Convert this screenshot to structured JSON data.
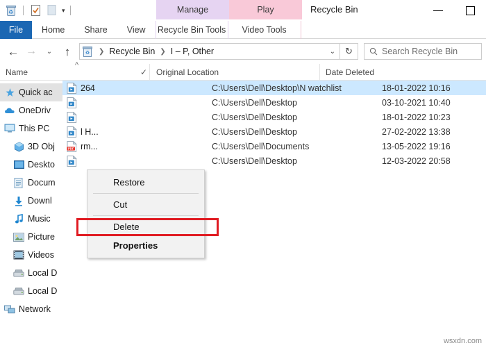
{
  "window": {
    "title": "Recycle Bin",
    "controls": {
      "minimize": "minimize-button",
      "maximize": "maximize-button"
    }
  },
  "quick_access_toolbar": {
    "items": [
      {
        "name": "recycle-bin-icon",
        "label": "Recycle Bin Properties"
      },
      {
        "name": "properties-icon",
        "label": "Properties"
      },
      {
        "name": "empty-recycle-bin-icon",
        "label": "Empty Recycle Bin"
      }
    ],
    "customize_caret": "▾"
  },
  "contextual_tabs": [
    {
      "header": "Manage",
      "tab": "Recycle Bin Tools",
      "color": "#e6d4f2"
    },
    {
      "header": "Play",
      "tab": "Video Tools",
      "color": "#f9c9d8"
    }
  ],
  "ribbon_tabs": [
    {
      "label": "File",
      "active": true
    },
    {
      "label": "Home",
      "active": false
    },
    {
      "label": "Share",
      "active": false
    },
    {
      "label": "View",
      "active": false
    }
  ],
  "address_bar": {
    "back": "←",
    "forward": "→",
    "recent": "⌄",
    "up": "↑",
    "breadcrumb": [
      "Recycle Bin",
      "I – P, Other"
    ],
    "separator": "❯",
    "dropdown_caret": "⌄",
    "refresh": "↻"
  },
  "search": {
    "placeholder": "Search Recycle Bin",
    "icon": "search-icon"
  },
  "columns": [
    {
      "label": "Name",
      "sort": "^"
    },
    {
      "label": "Original Location",
      "check": "✓"
    },
    {
      "label": "Date Deleted"
    }
  ],
  "sidebar": {
    "items": [
      {
        "label": "Quick ac",
        "icon": "pin-icon",
        "selected": true,
        "indent": false
      },
      {
        "label": "OneDriv",
        "icon": "cloud-icon",
        "selected": false,
        "indent": false
      },
      {
        "label": "This PC",
        "icon": "monitor-icon",
        "selected": false,
        "indent": false
      },
      {
        "label": "3D Obj",
        "icon": "3d-objects-icon",
        "selected": false,
        "indent": true
      },
      {
        "label": "Deskto",
        "icon": "desktop-icon",
        "selected": false,
        "indent": true
      },
      {
        "label": "Docum",
        "icon": "documents-icon",
        "selected": false,
        "indent": true
      },
      {
        "label": "Downl",
        "icon": "downloads-icon",
        "selected": false,
        "indent": true
      },
      {
        "label": "Music",
        "icon": "music-icon",
        "selected": false,
        "indent": true
      },
      {
        "label": "Picture",
        "icon": "pictures-icon",
        "selected": false,
        "indent": true
      },
      {
        "label": "Videos",
        "icon": "videos-icon",
        "selected": false,
        "indent": true
      },
      {
        "label": "Local D",
        "icon": "local-disk-icon",
        "selected": false,
        "indent": true
      },
      {
        "label": "Local D",
        "icon": "local-disk-icon",
        "selected": false,
        "indent": true
      },
      {
        "label": "Network",
        "icon": "network-icon",
        "selected": false,
        "indent": false
      }
    ]
  },
  "files": [
    {
      "name": "264",
      "location": "C:\\Users\\Dell\\Desktop\\N watchlist",
      "date": "18-01-2022 10:16",
      "icon": "video-file-icon",
      "selected": true
    },
    {
      "name": "",
      "location": "C:\\Users\\Dell\\Desktop",
      "date": "03-10-2021 10:40",
      "icon": "video-file-icon",
      "selected": false
    },
    {
      "name": "",
      "location": "C:\\Users\\Dell\\Desktop",
      "date": "18-01-2022 10:23",
      "icon": "video-file-icon",
      "selected": false
    },
    {
      "name": "l H...",
      "location": "C:\\Users\\Dell\\Desktop",
      "date": "27-02-2022 13:38",
      "icon": "video-file-icon",
      "selected": false
    },
    {
      "name": "rm...",
      "location": "C:\\Users\\Dell\\Documents",
      "date": "13-05-2022 19:16",
      "icon": "pdf-file-icon",
      "selected": false
    },
    {
      "name": "",
      "location": "C:\\Users\\Dell\\Desktop",
      "date": "12-03-2022 20:58",
      "icon": "video-file-icon",
      "selected": false
    }
  ],
  "context_menu": {
    "items": [
      {
        "label": "Restore",
        "bold": false,
        "highlighted": false
      },
      {
        "label": "Cut",
        "bold": false,
        "highlighted": false
      },
      {
        "label": "Delete",
        "bold": false,
        "highlighted": true
      },
      {
        "label": "Properties",
        "bold": true,
        "highlighted": false
      }
    ],
    "highlight_color": "#e01b22"
  },
  "watermark": "wsxdn.com"
}
